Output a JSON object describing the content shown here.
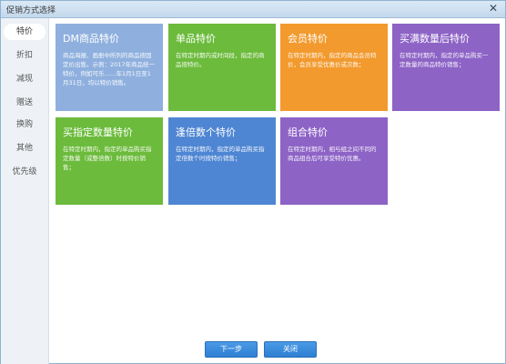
{
  "window": {
    "title": "促销方式选择",
    "close_glyph": "✕"
  },
  "sidebar": {
    "items": [
      {
        "label": "特价",
        "active": true
      },
      {
        "label": "折扣",
        "active": false
      },
      {
        "label": "减现",
        "active": false
      },
      {
        "label": "赠送",
        "active": false
      },
      {
        "label": "换购",
        "active": false
      },
      {
        "label": "其他",
        "active": false
      },
      {
        "label": "优先级",
        "active": false
      }
    ]
  },
  "tiles": [
    {
      "title": "DM商品特价",
      "desc": "商品海报、画册中所列的商品按固定价出售。示例：2017年商品统一特价，例如可乐……年1月1日至1月31日，均以特价销售。",
      "color": "#8fb0de"
    },
    {
      "title": "单品特价",
      "desc": "在特定时期内或时间段，指定的商品按特价。",
      "color": "#6cbb3c"
    },
    {
      "title": "会员特价",
      "desc": "在特定时期内，指定的商品会员特价，会员享受优惠价或次数；",
      "color": "#f29a2e"
    },
    {
      "title": "买满数量后特价",
      "desc": "在特定时期内，指定的单品购买一定数量的商品特价销售；",
      "color": "#8d63c6"
    },
    {
      "title": "买指定数量特价",
      "desc": "在特定时期内，指定的单品购买指定数量（或整倍数）时按特价销售；",
      "color": "#6cbb3c"
    },
    {
      "title": "逢倍数个特价",
      "desc": "在特定时期内，指定的单品购买指定倍数个时按特价销售；",
      "color": "#4f86d3"
    },
    {
      "title": "组合特价",
      "desc": "在特定时期内，相与组之间不同的商品组合后可享受特价优惠。",
      "color": "#8d63c6"
    }
  ],
  "footer": {
    "next_label": "下一步",
    "close_label": "关闭"
  }
}
